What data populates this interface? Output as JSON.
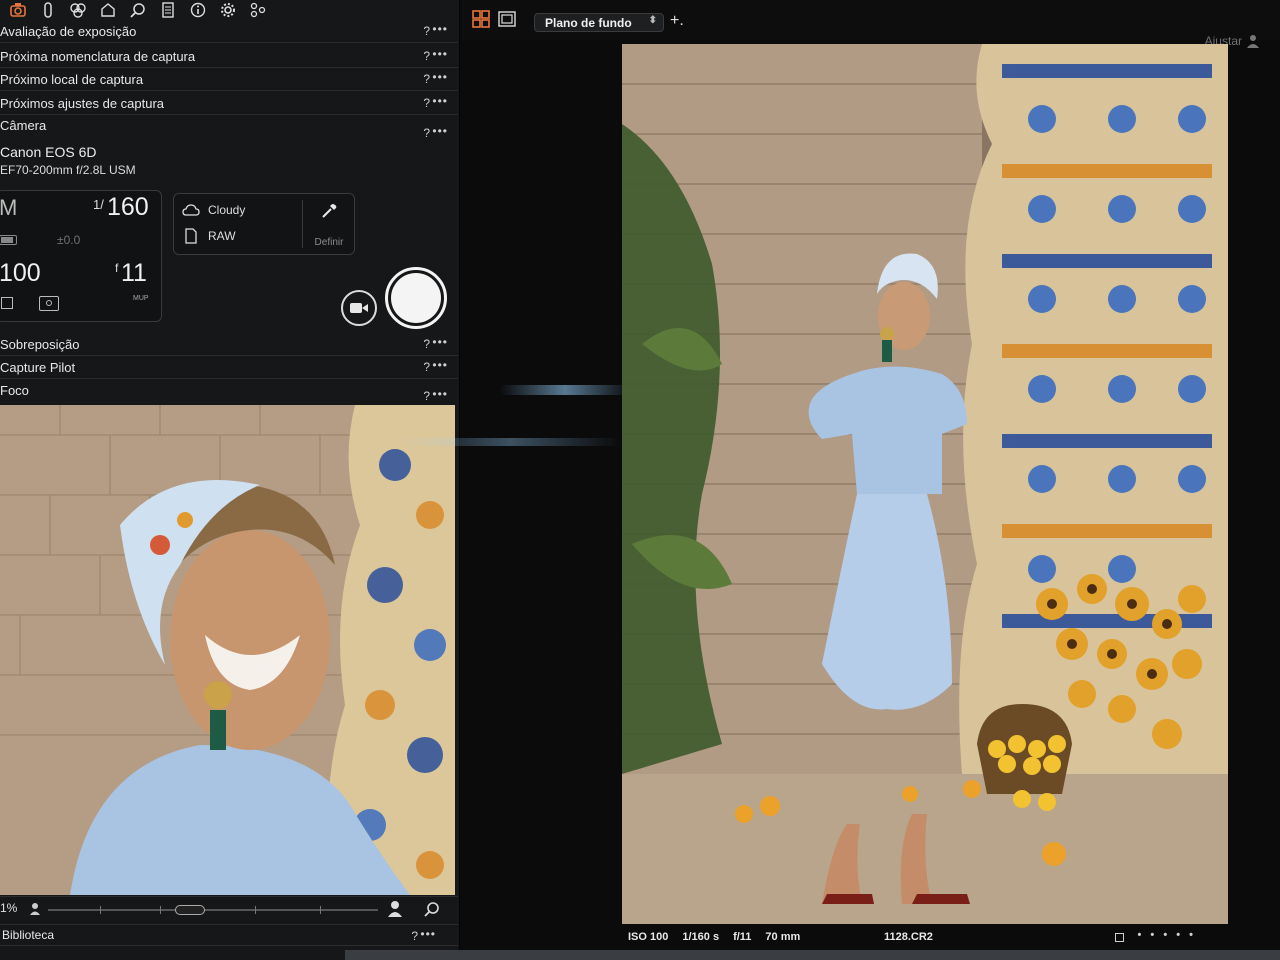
{
  "panel": {
    "sections": {
      "exposure_evaluation": "Avaliação de exposição",
      "next_capture_naming": "Próxima nomenclatura de captura",
      "next_capture_location": "Próximo local de captura",
      "next_capture_adjustments": "Próximos ajustes de captura",
      "camera": "Câmera",
      "overlay": "Sobreposição",
      "capture_pilot": "Capture Pilot",
      "focus": "Foco",
      "library": "Biblioteca"
    },
    "help": "?",
    "more": "•••"
  },
  "camera": {
    "model": "Canon EOS 6D",
    "lens": "EF70-200mm f/2.8L USM",
    "mode": "M",
    "shutter_num": "1/",
    "shutter_den": "160",
    "exposure_comp": "±0.0",
    "iso": "100",
    "aperture_prefix": "f",
    "aperture": "11",
    "mup": "MUP",
    "white_balance": "Cloudy",
    "format": "RAW",
    "define": "Definir"
  },
  "focus_toolbar": {
    "zoom": "1%"
  },
  "viewer": {
    "background_select": "Plano de fundo",
    "add": "+.",
    "adjust": "Ajustar"
  },
  "photo_info": {
    "iso": "ISO 100",
    "shutter": "1/160 s",
    "aperture": "f/11",
    "focal": "70 mm",
    "file": "1128.CR2",
    "more": "• • • • •"
  },
  "colors": {
    "panel_bg": "#161718",
    "accent_orange": "#e8743b",
    "viewer_bg": "#0b0b0c"
  }
}
